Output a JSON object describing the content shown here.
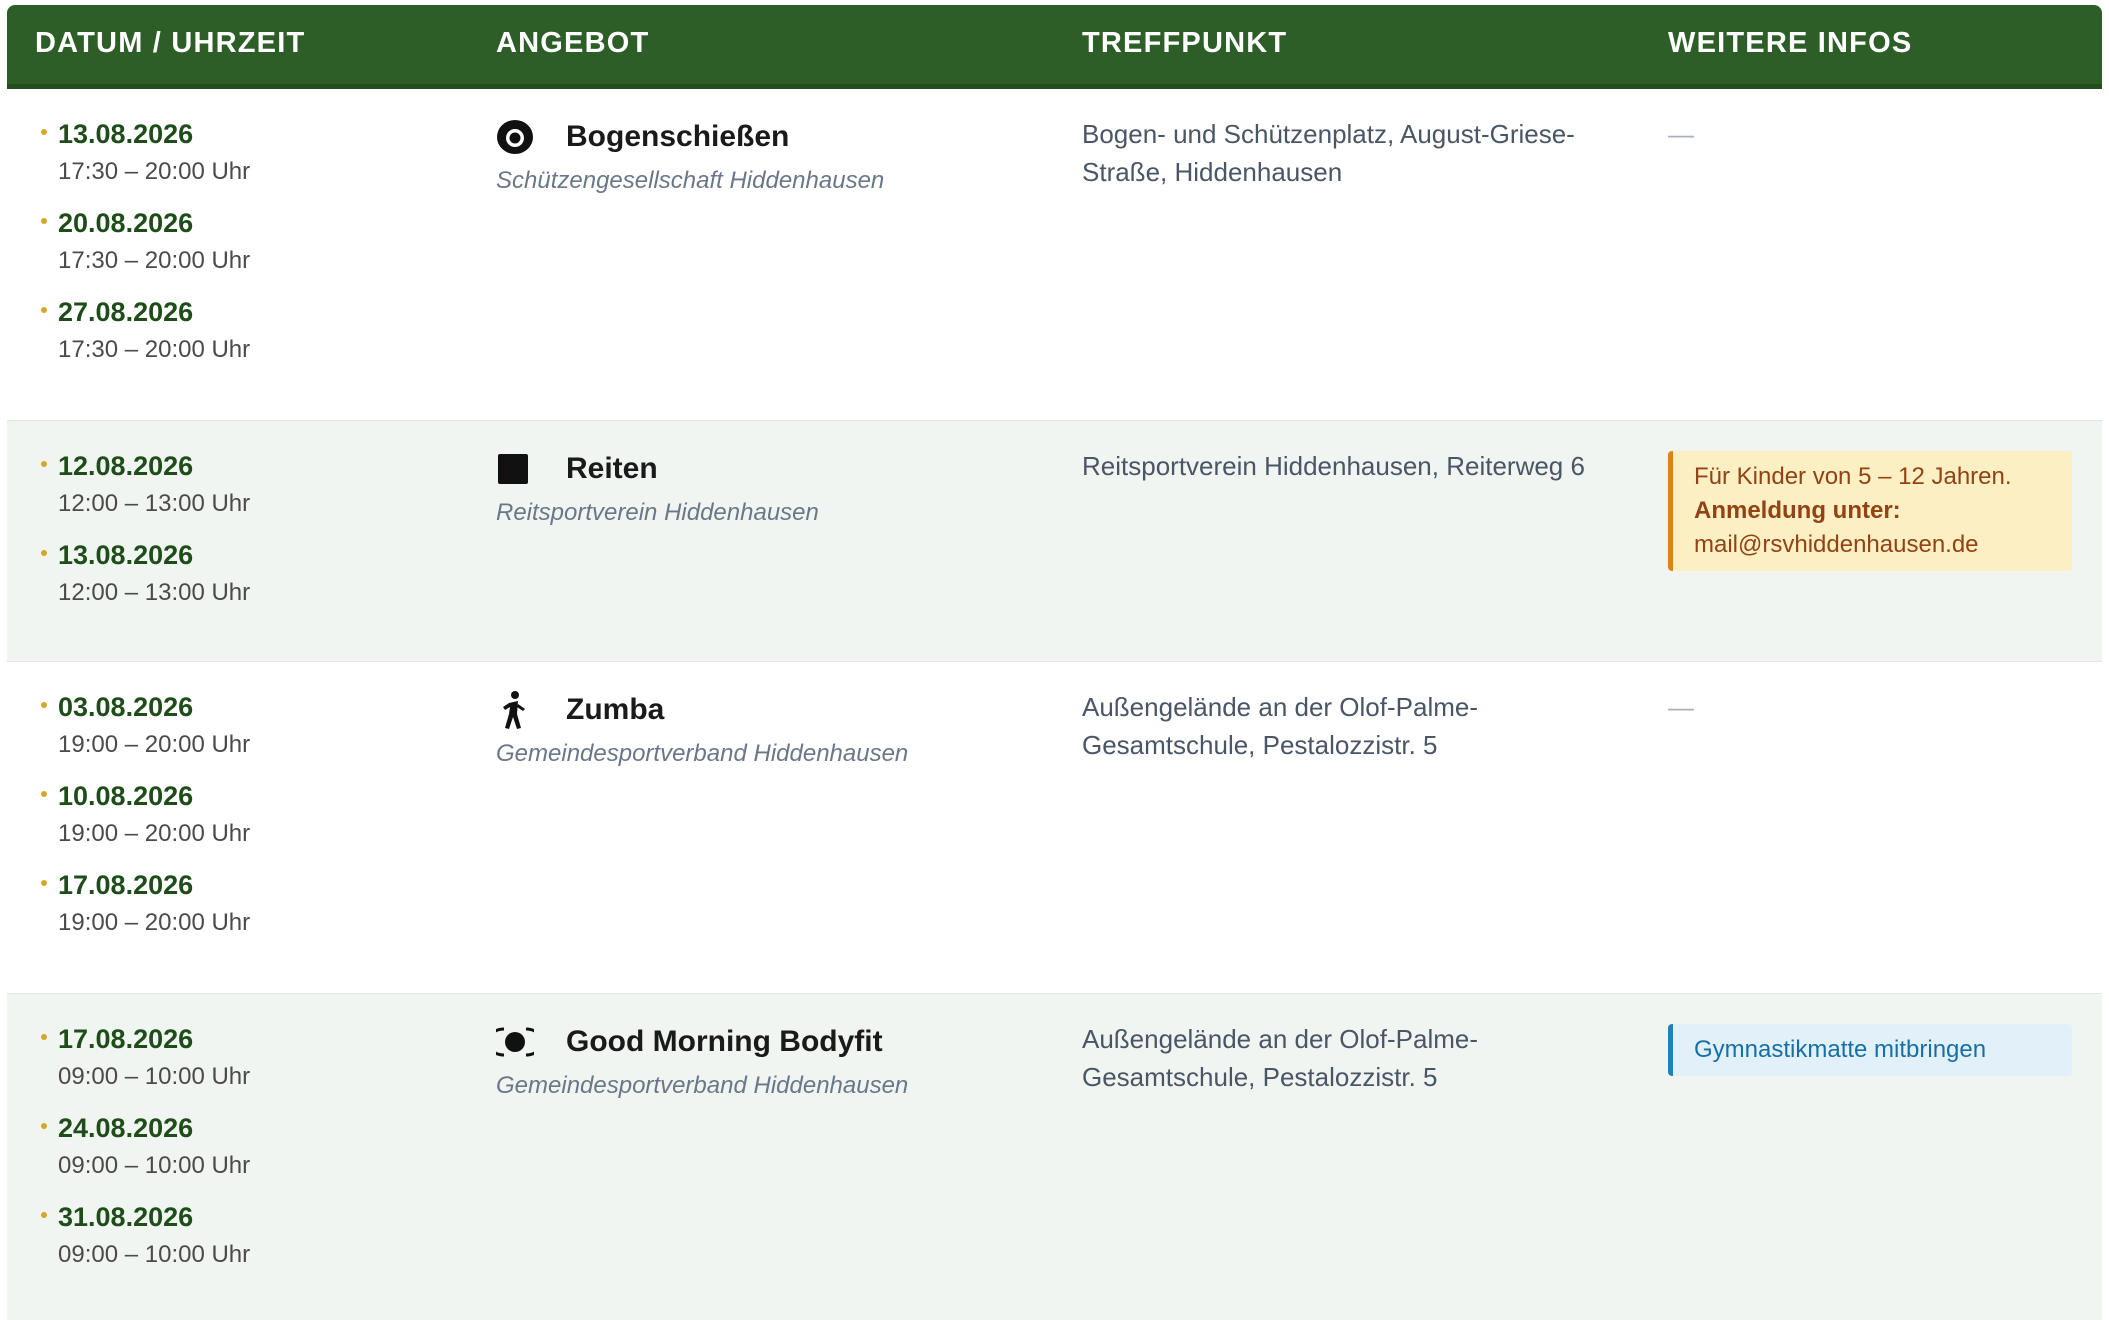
{
  "header": {
    "date_time": "DATUM / UHRZEIT",
    "offer": "ANGEBOT",
    "meeting_point": "TREFFPUNKT",
    "more_info": "WEITERE INFOS"
  },
  "rows": [
    {
      "dates": [
        {
          "date": "13.08.2026",
          "time": "17:30 – 20:00 Uhr"
        },
        {
          "date": "20.08.2026",
          "time": "17:30 – 20:00 Uhr"
        },
        {
          "date": "27.08.2026",
          "time": "17:30 – 20:00 Uhr"
        }
      ],
      "offer": {
        "icon": "target-icon",
        "name": "Bogenschießen",
        "org": "Schützengesellschaft Hiddenhausen"
      },
      "meeting_point": "Bogen- und Schützenplatz, August-Griese-Straße, Hiddenhausen",
      "info": {
        "empty": "—"
      }
    },
    {
      "dates": [
        {
          "date": "12.08.2026",
          "time": "12:00 – 13:00 Uhr"
        },
        {
          "date": "13.08.2026",
          "time": "12:00 – 13:00 Uhr"
        }
      ],
      "offer": {
        "icon": "square-icon",
        "name": "Reiten",
        "org": "Reitsportverein Hiddenhausen"
      },
      "meeting_point": "Reitsportverein Hiddenhausen, Reiterweg 6",
      "info": {
        "text": "Für Kinder von 5 – 12 Jahren.",
        "bold": "Anmeldung unter:",
        "email": "mail@rsvhiddenhausen.de"
      }
    },
    {
      "dates": [
        {
          "date": "03.08.2026",
          "time": "19:00 – 20:00 Uhr"
        },
        {
          "date": "10.08.2026",
          "time": "19:00 – 20:00 Uhr"
        },
        {
          "date": "17.08.2026",
          "time": "19:00 – 20:00 Uhr"
        }
      ],
      "offer": {
        "icon": "walking-person-icon",
        "name": "Zumba",
        "org": "Gemeindesportverband Hiddenhausen"
      },
      "meeting_point": "Außengelände an der Olof-Palme-Gesamtschule, Pestalozzistr. 5",
      "info": {
        "empty": "—"
      }
    },
    {
      "dates": [
        {
          "date": "17.08.2026",
          "time": "09:00 – 10:00 Uhr"
        },
        {
          "date": "24.08.2026",
          "time": "09:00 – 10:00 Uhr"
        },
        {
          "date": "31.08.2026",
          "time": "09:00 – 10:00 Uhr"
        }
      ],
      "offer": {
        "icon": "sun-icon",
        "name": "Good Morning Bodyfit",
        "org": "Gemeindesportverband Hiddenhausen"
      },
      "meeting_point": "Außengelände an der Olof-Palme-Gesamtschule, Pestalozzistr. 5",
      "info": {
        "note": "Gymnastikmatte mitbringen"
      }
    }
  ],
  "colors": {
    "header_bg": "#2e5e28",
    "date_text": "#1f4d1a",
    "bullet": "#d4a72c",
    "alt_row_bg": "#f1f5f1",
    "warn_bg": "#fcefc4",
    "warn_border": "#e08214",
    "note_bg": "#e2f0f9",
    "note_border": "#1f82bd"
  }
}
